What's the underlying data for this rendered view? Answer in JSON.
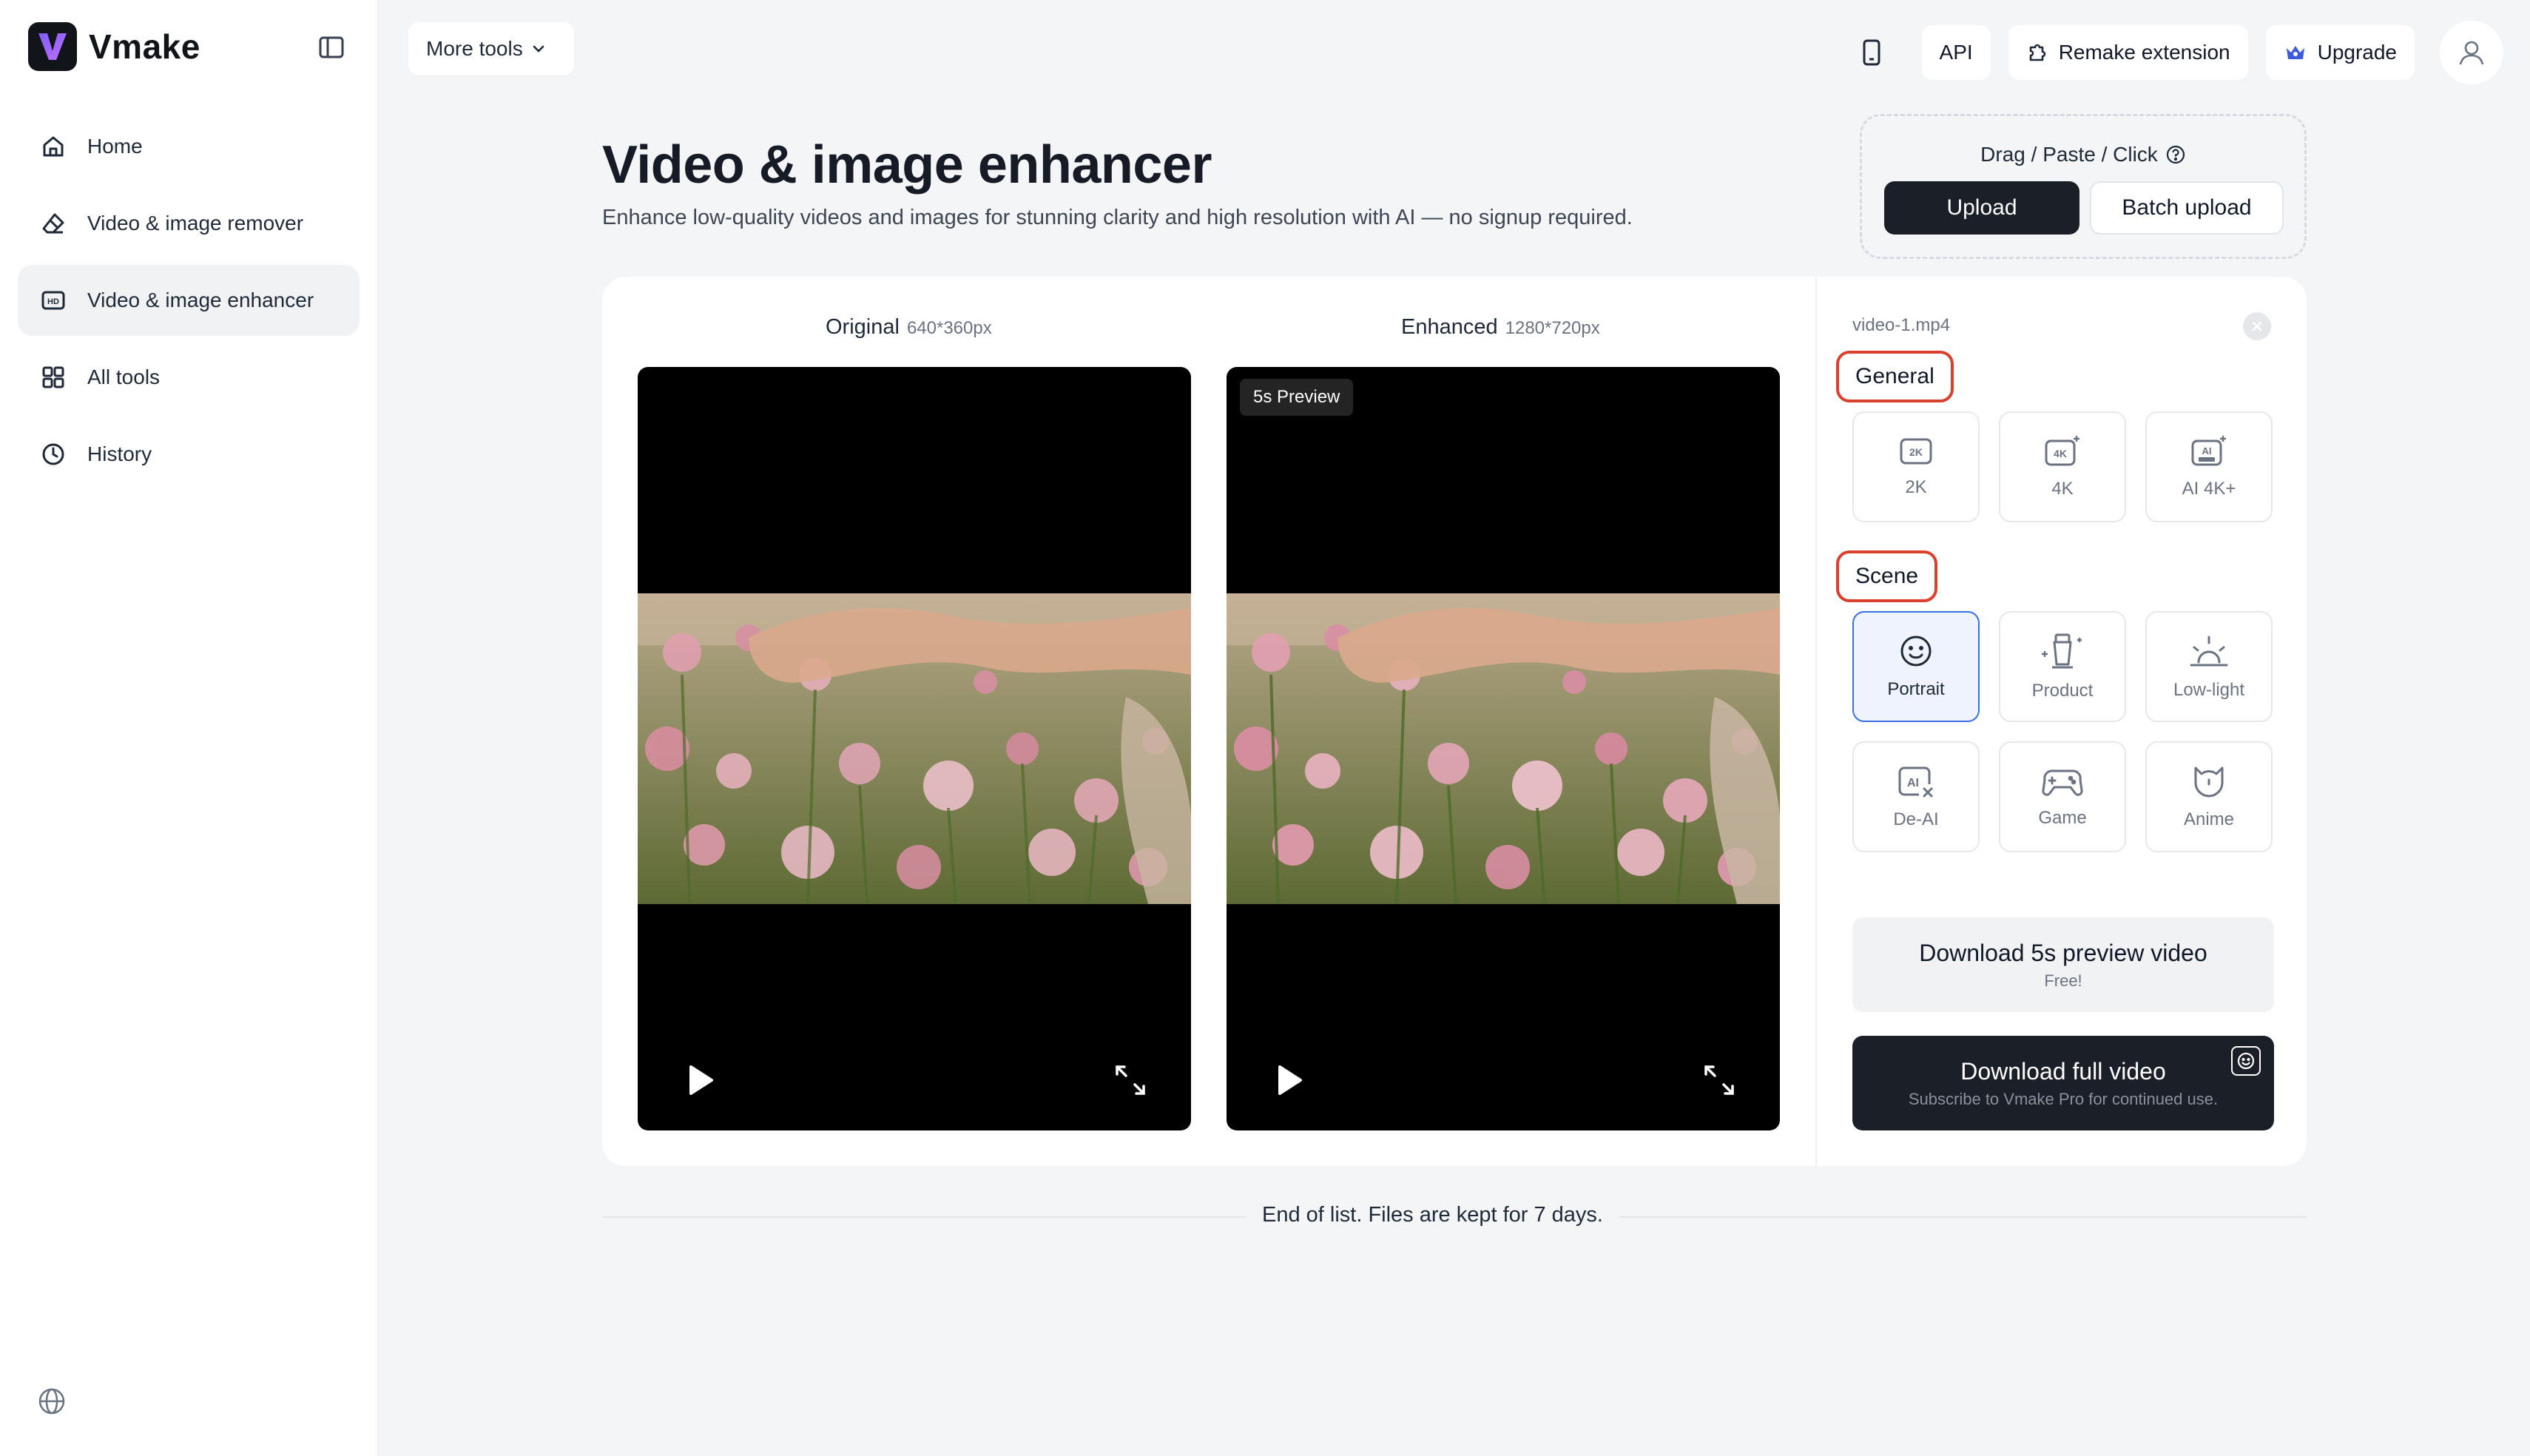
{
  "app": {
    "name": "Vmake",
    "accent": "#7c3aed"
  },
  "sidebar": {
    "items": [
      {
        "label": "Home",
        "icon": "home-icon"
      },
      {
        "label": "Video & image remover",
        "icon": "eraser-icon"
      },
      {
        "label": "Video & image enhancer",
        "icon": "hd-icon",
        "active": true
      },
      {
        "label": "All tools",
        "icon": "grid-icon"
      },
      {
        "label": "History",
        "icon": "clock-icon"
      }
    ]
  },
  "topbar": {
    "more_tools": "More tools",
    "api": "API",
    "extension": "Remake extension",
    "upgrade": "Upgrade"
  },
  "header": {
    "title": "Video & image enhancer",
    "subtitle": "Enhance low-quality videos and images for stunning clarity and high resolution with AI — no signup required."
  },
  "upload": {
    "hint": "Drag / Paste / Click",
    "upload_label": "Upload",
    "batch_label": "Batch upload"
  },
  "compare": {
    "original_label": "Original",
    "original_dim": "640*360px",
    "enhanced_label": "Enhanced",
    "enhanced_dim": "1280*720px",
    "preview_badge": "5s Preview"
  },
  "panel": {
    "file_name": "video-1.mp4",
    "general_label": "General",
    "general_options": [
      "2K",
      "4K",
      "AI 4K+"
    ],
    "scene_label": "Scene",
    "scene_options": [
      "Portrait",
      "Product",
      "Low-light",
      "De-AI",
      "Game",
      "Anime"
    ],
    "selected_scene": "Portrait",
    "download_preview": {
      "title": "Download 5s preview video",
      "sub": "Free!"
    },
    "download_full": {
      "title": "Download full video",
      "sub": "Subscribe to Vmake Pro for continued use."
    }
  },
  "footer": {
    "text": "End of list. Files are kept for 7 days."
  }
}
